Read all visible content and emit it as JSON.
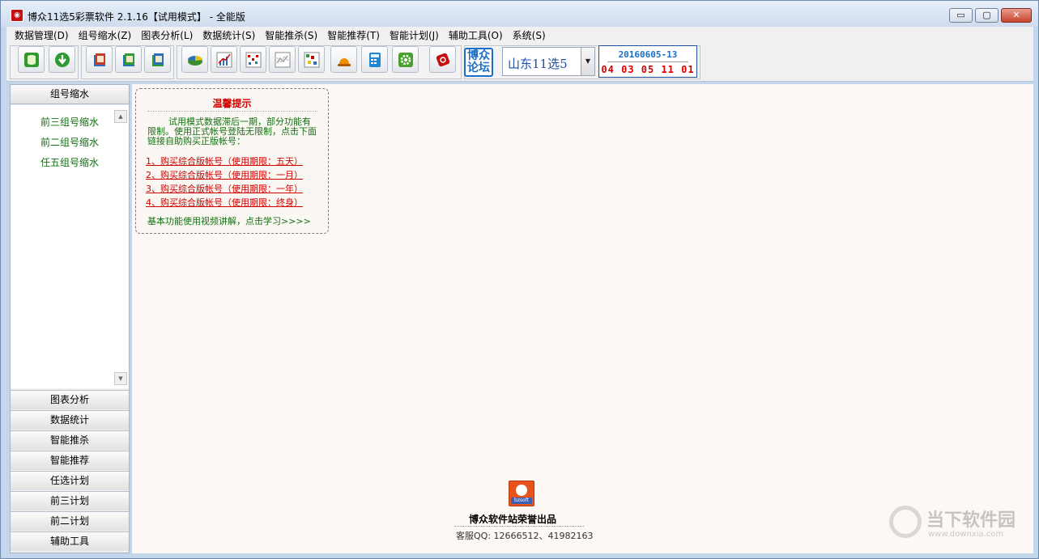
{
  "window": {
    "title": "博众11选5彩票软件 2.1.16【试用模式】 - 全能版",
    "controls": {
      "minimize": "▭",
      "maximize": "▢",
      "close": "✕"
    }
  },
  "menubar": {
    "items": [
      "数据管理(D)",
      "组号缩水(Z)",
      "图表分析(L)",
      "数据统计(S)",
      "智能推杀(S)",
      "智能推荐(T)",
      "智能计划(J)",
      "辅助工具(O)",
      "系统(S)"
    ]
  },
  "toolbar": {
    "icons": [
      "database-icon",
      "download-icon",
      "book-red-icon",
      "book-green-icon",
      "book-blue-icon",
      "pie-chart-icon",
      "line-chart-icon",
      "grid-chart-icon",
      "trend-chart-icon",
      "matrix-chart-icon",
      "alarm-icon",
      "calculator-icon",
      "settings-icon",
      "red-stamp-icon"
    ],
    "forum_label_line1": "博众",
    "forum_label_line2": "论坛",
    "lottery_select": "山东11选5",
    "draw_issue": "20160605-13",
    "draw_numbers": "04 03 05 11 01",
    "colors": {
      "issue": "#1b6fc7",
      "numbers": "#d40000"
    }
  },
  "sidebar": {
    "header": "组号缩水",
    "links": [
      "前三组号缩水",
      "前二组号缩水",
      "任五组号缩水"
    ],
    "sections": [
      "图表分析",
      "数据统计",
      "智能推杀",
      "智能推荐",
      "任选计划",
      "前三计划",
      "前二计划",
      "辅助工具"
    ]
  },
  "notice": {
    "title": "温馨提示",
    "body": "试用模式数据滞后一期，部分功能有限制。使用正式帐号登陆无限制，点击下面链接自助购买正版帐号：",
    "links": [
      "1、购买综合版帐号（使用期限：五天）",
      "2、购买综合版帐号（使用期限：一月）",
      "3、购买综合版帐号（使用期限：一年）",
      "4、购买综合版帐号（使用期限：终身）"
    ],
    "footer": "基本功能使用视频讲解，点击学习>>>>"
  },
  "credit": {
    "logo_text": "bzsoft",
    "line": "博众软件站荣誉出品",
    "qq": "客服QQ: 12666512、41982163"
  },
  "watermark": {
    "text": "当下软件园",
    "url": "www.downxia.com"
  }
}
